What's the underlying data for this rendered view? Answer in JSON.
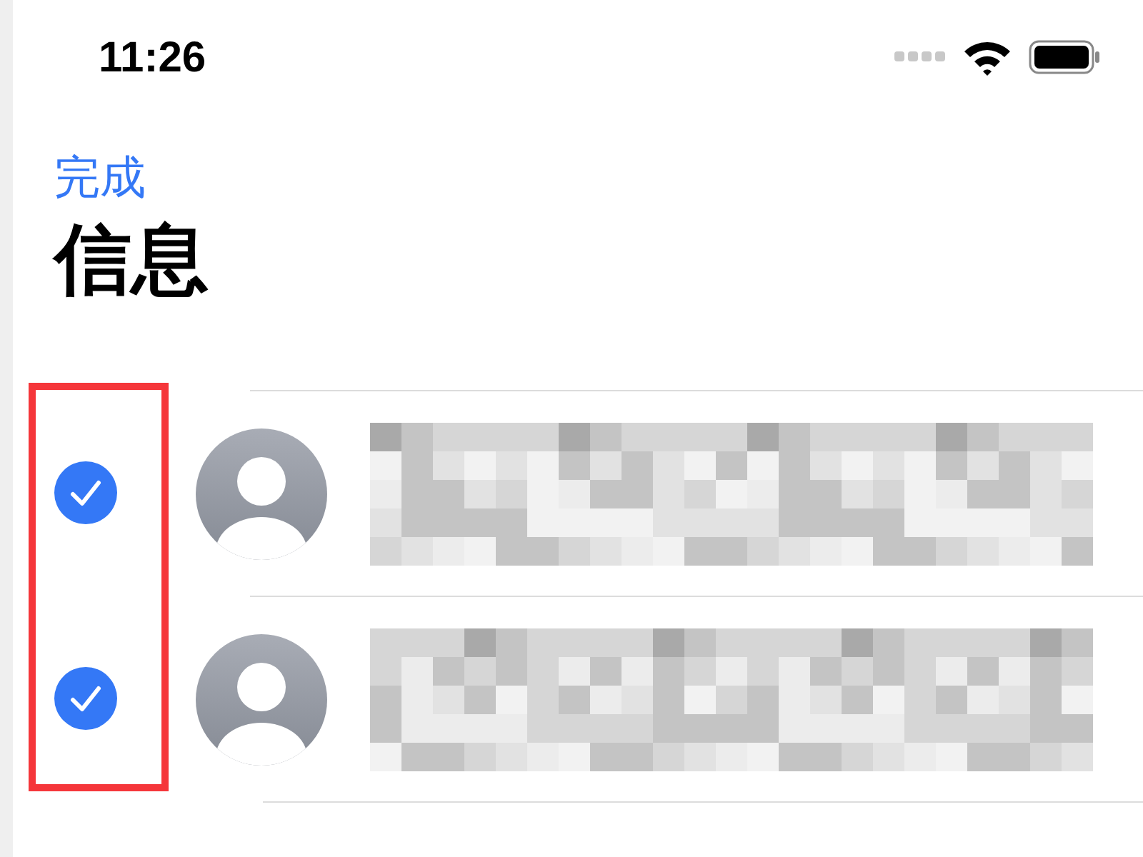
{
  "status_bar": {
    "time": "11:26"
  },
  "nav": {
    "done": "完成",
    "title": "信息"
  },
  "messages": [
    {
      "selected": true
    },
    {
      "selected": true
    }
  ],
  "highlight": {
    "shown": true
  }
}
